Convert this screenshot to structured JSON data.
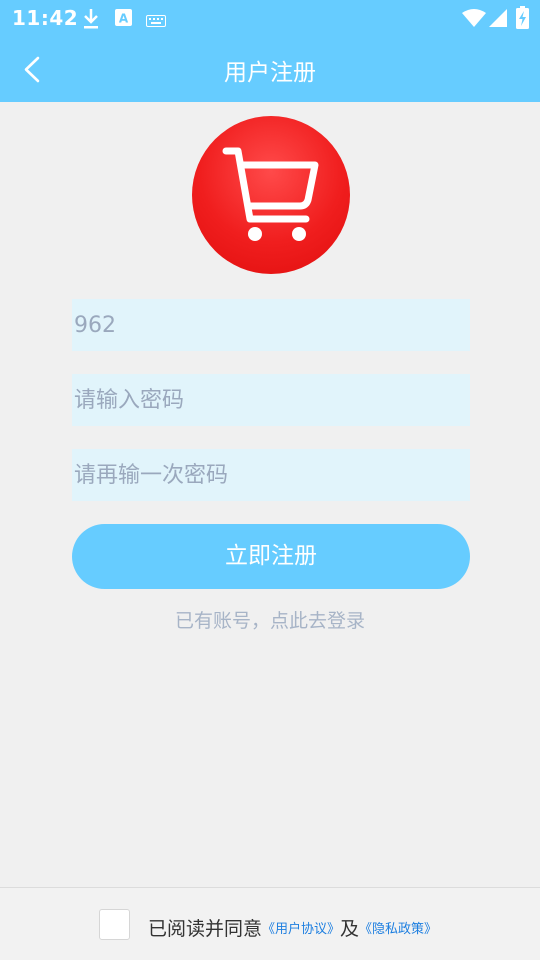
{
  "status_bar": {
    "time": "11:42",
    "icons": [
      "download-icon",
      "a-notification-icon",
      "keyboard-icon",
      "wifi-icon",
      "signal-icon",
      "battery-charging-icon"
    ]
  },
  "toolbar": {
    "back_icon": "back-arrow-icon",
    "title": "用户注册"
  },
  "logo": {
    "icon": "shopping-cart-icon",
    "color": "#f01e1e"
  },
  "form": {
    "username_value": "962",
    "password_placeholder": "请输入密码",
    "confirm_placeholder": "请再输一次密码",
    "register_label": "立即注册",
    "login_link": "已有账号，点此去登录"
  },
  "footer": {
    "checkbox_checked": false,
    "agree_text": "已阅读并同意",
    "user_agreement_link": "《用户协议》",
    "and_text": "及",
    "privacy_link": "《隐私政策》"
  },
  "colors": {
    "accent": "#66ccff",
    "input_bg": "#e1f4fb",
    "link": "#1e7fe0",
    "background": "#f0f0f0"
  }
}
